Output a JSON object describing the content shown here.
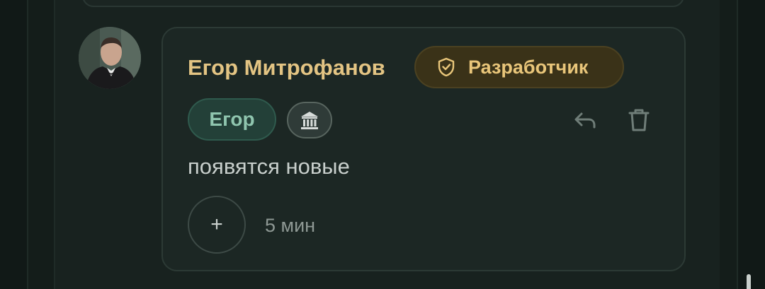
{
  "comment": {
    "author_name": "Егор Митрофанов",
    "role_badge": "Разработчик",
    "name_chip": "Егор",
    "message": "появятся новые",
    "add_reaction_label": "+",
    "timestamp": "5 мин"
  },
  "icons": {
    "role": "shield-check-icon",
    "institution": "institution-icon",
    "reply": "reply-icon",
    "delete": "trash-icon"
  },
  "colors": {
    "author": "#e3c483",
    "role_badge_bg": "#3a3218",
    "role_badge_text": "#e9c67a",
    "name_chip_bg": "#234038",
    "name_chip_text": "#8fc5ae",
    "card_bg": "#1c2724"
  }
}
